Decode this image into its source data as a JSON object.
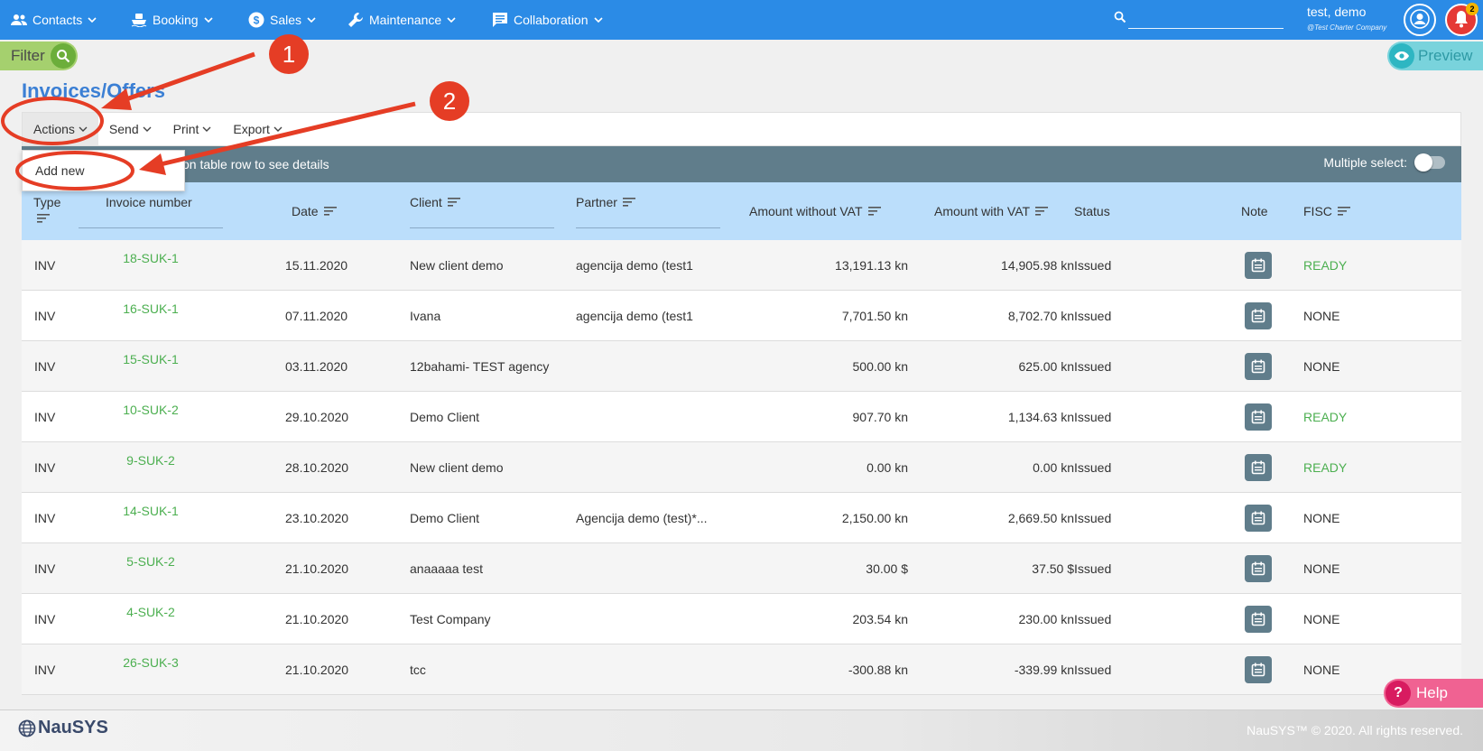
{
  "nav": {
    "items": [
      {
        "label": "Contacts",
        "icon": "people-icon"
      },
      {
        "label": "Booking",
        "icon": "boat-icon"
      },
      {
        "label": "Sales",
        "icon": "dollar-icon"
      },
      {
        "label": "Maintenance",
        "icon": "wrench-icon"
      },
      {
        "label": "Collaboration",
        "icon": "chat-icon"
      }
    ],
    "search_value": "",
    "user_name": "test, demo",
    "user_company": "@Test Charter Company",
    "notification_count": "2"
  },
  "filter_label": "Filter",
  "preview_label": "Preview",
  "page_title": "Invoices/Offers",
  "toolbar": {
    "actions": "Actions",
    "send": "Send",
    "print": "Print",
    "export": "Export"
  },
  "dropdown": {
    "add_new": "Add new"
  },
  "info_strip": {
    "hint": "on table row to see details",
    "multiple_select": "Multiple select:"
  },
  "columns": {
    "type": "Type",
    "invoice_number": "Invoice number",
    "date": "Date",
    "client": "Client",
    "partner": "Partner",
    "amount_without_vat": "Amount without VAT",
    "amount_with_vat": "Amount with VAT",
    "status": "Status",
    "note": "Note",
    "fisc": "FISC"
  },
  "rows": [
    {
      "type": "INV",
      "number": "18-SUK-1",
      "date": "15.11.2020",
      "client": "New client demo",
      "partner": "agencija demo (test1",
      "without_vat": "13,191.13 kn",
      "with_vat": "14,905.98 kn",
      "status": "Issued",
      "fisc": "READY"
    },
    {
      "type": "INV",
      "number": "16-SUK-1",
      "date": "07.11.2020",
      "client": "Ivana",
      "partner": "agencija demo (test1",
      "without_vat": "7,701.50 kn",
      "with_vat": "8,702.70 kn",
      "status": "Issued",
      "fisc": "NONE"
    },
    {
      "type": "INV",
      "number": "15-SUK-1",
      "date": "03.11.2020",
      "client": "12bahami- TEST agency",
      "partner": "",
      "without_vat": "500.00 kn",
      "with_vat": "625.00 kn",
      "status": "Issued",
      "fisc": "NONE"
    },
    {
      "type": "INV",
      "number": "10-SUK-2",
      "date": "29.10.2020",
      "client": "Demo Client",
      "partner": "",
      "without_vat": "907.70 kn",
      "with_vat": "1,134.63 kn",
      "status": "Issued",
      "fisc": "READY"
    },
    {
      "type": "INV",
      "number": "9-SUK-2",
      "date": "28.10.2020",
      "client": "New client demo",
      "partner": "",
      "without_vat": "0.00 kn",
      "with_vat": "0.00 kn",
      "status": "Issued",
      "fisc": "READY"
    },
    {
      "type": "INV",
      "number": "14-SUK-1",
      "date": "23.10.2020",
      "client": "Demo Client",
      "partner": "Agencija demo (test)*...",
      "without_vat": "2,150.00 kn",
      "with_vat": "2,669.50 kn",
      "status": "Issued",
      "fisc": "NONE"
    },
    {
      "type": "INV",
      "number": "5-SUK-2",
      "date": "21.10.2020",
      "client": "anaaaaa test",
      "partner": "",
      "without_vat": "30.00 $",
      "with_vat": "37.50 $",
      "status": "Issued",
      "fisc": "NONE"
    },
    {
      "type": "INV",
      "number": "4-SUK-2",
      "date": "21.10.2020",
      "client": "Test Company",
      "partner": "",
      "without_vat": "203.54 kn",
      "with_vat": "230.00 kn",
      "status": "Issued",
      "fisc": "NONE"
    },
    {
      "type": "INV",
      "number": "26-SUK-3",
      "date": "21.10.2020",
      "client": "tcc",
      "partner": "",
      "without_vat": "-300.88 kn",
      "with_vat": "-339.99 kn",
      "status": "Issued",
      "fisc": "NONE"
    }
  ],
  "help_label": "Help",
  "footer": {
    "logo": "NauSYS",
    "copyright": "NauSYS™ © 2020. All rights reserved."
  },
  "annotations": {
    "step1": "1",
    "step2": "2"
  },
  "colors": {
    "nav": "#2b8be6",
    "accent_green": "#4caf50",
    "annotation_red": "#e53d25",
    "header_strip": "#607d8b"
  }
}
